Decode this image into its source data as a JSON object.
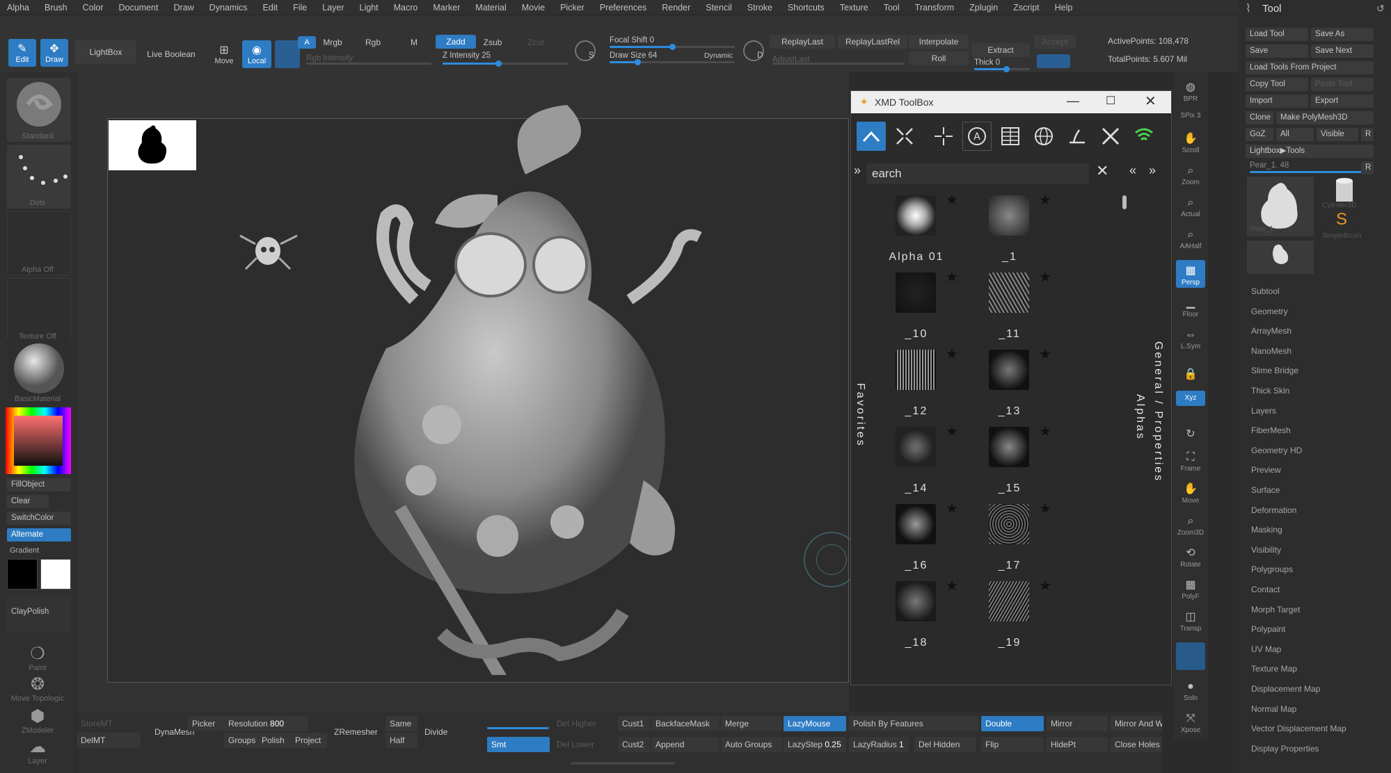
{
  "menu": [
    "Alpha",
    "Brush",
    "Color",
    "Document",
    "Draw",
    "Dynamics",
    "Edit",
    "File",
    "Layer",
    "Light",
    "Macro",
    "Marker",
    "Material",
    "Movie",
    "Picker",
    "Preferences",
    "Render",
    "Stencil",
    "Stroke",
    "Shortcuts",
    "Texture",
    "Tool",
    "Transform",
    "Zplugin",
    "Zscript",
    "Help"
  ],
  "toolbar": {
    "edit": "Edit",
    "draw": "Draw",
    "lightbox": "LightBox",
    "live_boolean": "Live Boolean",
    "move": "Move",
    "local": "Local",
    "a": "A",
    "mrgb": "Mrgb",
    "rgb": "Rgb",
    "m": "M",
    "rgb_intensity": "Rgb Intensity",
    "zadd": "Zadd",
    "zsub": "Zsub",
    "zcut": "Zcut",
    "z_intensity_label": "Z Intensity",
    "z_intensity_value": "25",
    "s_label": "S",
    "d_label": "D",
    "focal_shift_label": "Focal Shift",
    "focal_shift_value": "0",
    "draw_size_label": "Draw Size",
    "draw_size_value": "64",
    "dynamic": "Dynamic",
    "replay_last": "ReplayLast",
    "replay_last_rel": "ReplayLastRel",
    "interpolate": "Interpolate",
    "roll": "Roll",
    "extract": "Extract",
    "thick_label": "Thick",
    "thick_value": "0",
    "accept": "Accept",
    "adjust_last": "AdjustLast",
    "active_points": "ActivePoints: 108,478",
    "total_points": "TotalPoints: 5.607 Mil",
    "progress": 0.55
  },
  "left_shelf": {
    "standard": "Standard",
    "dots": "Dots",
    "alpha_off": "Alpha Off",
    "texture_off": "Texture Off",
    "basic_material": "BasicMaterial",
    "fill_object": "FillObject",
    "clear": "Clear",
    "switch_color": "SwitchColor",
    "alternate": "Alternate",
    "gradient": "Gradient",
    "clay_polish": "ClayPolish",
    "paint": "Paint",
    "move_topologic": "Move Topologic",
    "zmodeler": "ZModeler",
    "layer": "Layer"
  },
  "xmd": {
    "title": "XMD ToolBox",
    "search_placeholder": "earch",
    "side_favorites": "Favorites",
    "side_alphas": "Alphas",
    "side_general": "General / Properties",
    "items": [
      {
        "label": "Alpha 01"
      },
      {
        "label": "_1"
      },
      {
        "label": "_10"
      },
      {
        "label": "_11"
      },
      {
        "label": "_12"
      },
      {
        "label": "_13"
      },
      {
        "label": "_14"
      },
      {
        "label": "_15"
      },
      {
        "label": "_16"
      },
      {
        "label": "_17"
      },
      {
        "label": "_18"
      },
      {
        "label": "_19"
      }
    ]
  },
  "vstrip": {
    "bpr": "BPR",
    "spix": "SPix 3",
    "scroll": "Scroll",
    "zoom": "Zoom",
    "actual": "Actual",
    "aahalf": "AAHalf",
    "persp": "Persp",
    "floor": "Floor",
    "lsym": "L.Sym",
    "xyz": "Xyz",
    "frame": "Frame",
    "move": "Move",
    "zoom3d": "Zoom3D",
    "rotate": "Rotate",
    "polyf": "PolyF",
    "transp": "Transp",
    "solo": "Solo",
    "xpose": "Xpose"
  },
  "tool": {
    "title": "Tool",
    "load_tool": "Load Tool",
    "save_as": "Save As",
    "save": "Save",
    "save_next": "Save Next",
    "load_from_project": "Load Tools From Project",
    "copy_tool": "Copy Tool",
    "paste_tool": "Paste Tool",
    "import": "Import",
    "export": "Export",
    "clone": "Clone",
    "make_polymesh": "Make PolyMesh3D",
    "goz": "GoZ",
    "all": "All",
    "visible": "Visible",
    "r": "R",
    "lightbox_tools": "Lightbox▶Tools",
    "pear_label": "Pear_1. 48",
    "thumb_cylinder": "Cylinder3D",
    "thumb_simplebrush": "SimpleBrush",
    "thumb_pear": "Pear_1",
    "sections": [
      "Subtool",
      "Geometry",
      "ArrayMesh",
      "NanoMesh",
      "Slime Bridge",
      "Thick Skin",
      "Layers",
      "FiberMesh",
      "Geometry HD",
      "Preview",
      "Surface",
      "Deformation",
      "Masking",
      "Visibility",
      "Polygroups",
      "Contact",
      "Morph Target",
      "Polypaint",
      "UV Map",
      "Texture Map",
      "Displacement Map",
      "Normal Map",
      "Vector Displacement Map",
      "Display Properties"
    ]
  },
  "bottom": {
    "storemt": "StoreMT",
    "delmt": "DelMT",
    "dynamesh": "DynaMesh",
    "picker": "Picker",
    "resolution_label": "Resolution",
    "resolution_value": "800",
    "groups": "Groups",
    "polish": "Polish",
    "project": "Project",
    "zremesher": "ZRemesher",
    "same": "Same",
    "half": "Half",
    "divide": "Divide",
    "smt": "Smt",
    "del_higher": "Del Higher",
    "del_lower": "Del Lower",
    "cust1": "Cust1",
    "cust2": "Cust2",
    "backface_mask": "BackfaceMask",
    "append": "Append",
    "merge": "Merge",
    "auto_groups": "Auto Groups",
    "lazymouse": "LazyMouse",
    "lazystep_label": "LazyStep",
    "lazystep_value": "0.25",
    "polish_by_features": "Polish By Features",
    "lazyradius_label": "LazyRadius",
    "lazyradius_value": "1",
    "del_hidden": "Del Hidden",
    "double": "Double",
    "flip": "Flip",
    "mirror": "Mirror",
    "hidept": "HidePt",
    "mirror_and_weld": "Mirror And Weld",
    "close_holes": "Close Holes"
  },
  "colors": {
    "accent": "#2d7cc4",
    "bg": "#2b2b2b",
    "panel": "#333333"
  }
}
